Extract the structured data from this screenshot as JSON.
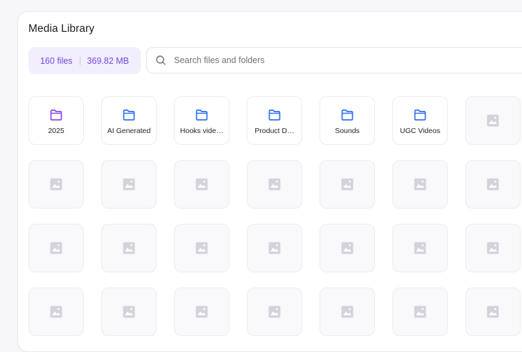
{
  "header": {
    "title": "Media Library"
  },
  "stats": {
    "files": "160 files",
    "size": "369.82 MB",
    "accent": "#7447e2",
    "bg": "#f1eefd"
  },
  "search": {
    "placeholder": "Search files and folders"
  },
  "folders": [
    {
      "name": "2025",
      "color": "#8b45e8"
    },
    {
      "name": "AI Generated",
      "color": "#2c6ff0"
    },
    {
      "name": "Hooks vide…",
      "color": "#2c6ff0"
    },
    {
      "name": "Product D…",
      "color": "#2c6ff0"
    },
    {
      "name": "Sounds",
      "color": "#2c6ff0"
    },
    {
      "name": "UGC Videos",
      "color": "#2c6ff0"
    }
  ],
  "media_placeholder": {
    "icon": "image-placeholder-icon",
    "count": 22,
    "color": "#d3d3dc"
  },
  "icons": {
    "search": "search-icon",
    "folder": "folder-icon"
  }
}
